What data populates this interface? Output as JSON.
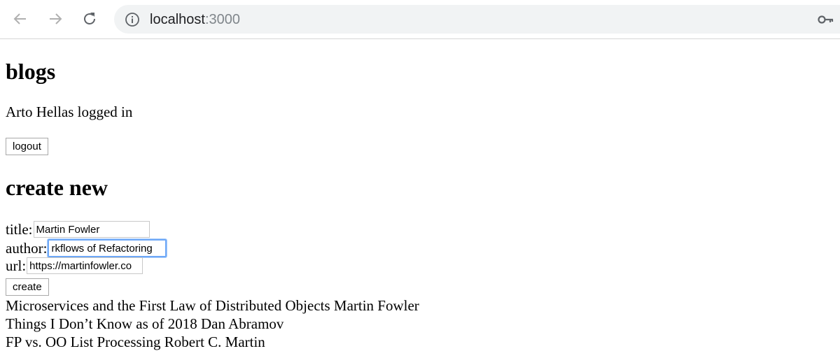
{
  "browser": {
    "url_host": "localhost",
    "url_port": ":3000",
    "icons": [
      "back-arrow-icon",
      "forward-arrow-icon",
      "reload-icon",
      "info-icon",
      "key-icon"
    ]
  },
  "page": {
    "heading": "blogs",
    "logged_in_text": "Arto Hellas logged in",
    "logout_label": "logout",
    "create_heading": "create new",
    "form": {
      "title_label": "title:",
      "title_value": "Martin Fowler",
      "author_label": "author:",
      "author_value": "rkflows of Refactoring",
      "url_label": "url:",
      "url_value": "https://martinfowler.co",
      "create_label": "create"
    },
    "blogs": [
      "Microservices and the First Law of Distributed Objects Martin Fowler",
      "Things I Don’t Know as of 2018 Dan Abramov",
      "FP vs. OO List Processing Robert C. Martin"
    ]
  },
  "colors": {
    "focus_ring": "#6ea8f7",
    "omnibox_bg": "#f1f3f4"
  }
}
